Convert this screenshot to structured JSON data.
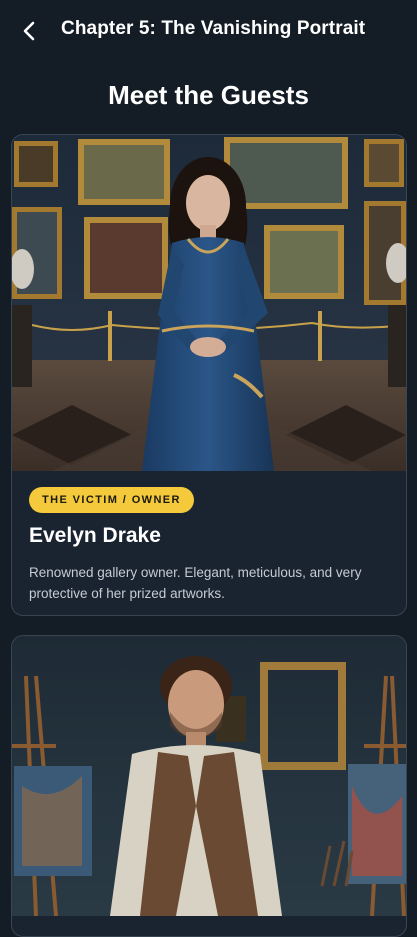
{
  "header": {
    "back_icon": "chevron-left-icon",
    "title": "Chapter 5: The Vanishing Portrait"
  },
  "section": {
    "title": "Meet the Guests"
  },
  "guests": [
    {
      "badge": "THE VICTIM / OWNER",
      "name": "Evelyn Drake",
      "description": "Renowned gallery owner. Elegant, meticulous, and very protective of her prized artworks."
    }
  ],
  "colors": {
    "background": "#141c25",
    "card": "#1a2330",
    "badge": "#f4c93b",
    "gown": "#234a78"
  }
}
